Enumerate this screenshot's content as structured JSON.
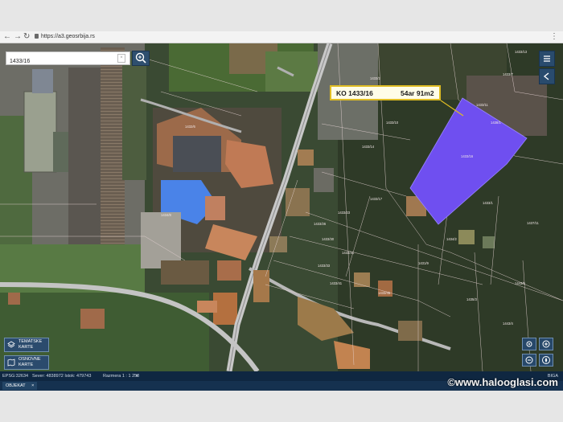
{
  "browser": {
    "back_icon": "arrow-left",
    "forward_icon": "arrow-right",
    "reload_icon": "reload",
    "url": "https://a3.geosrbija.rs",
    "menu_icon": "three-dots"
  },
  "search": {
    "value": "1433/16",
    "clear_label": "×",
    "button_icon": "search-zoom"
  },
  "right_toolbar": [
    {
      "icon": "menu-lines"
    },
    {
      "icon": "collapse-arrow"
    }
  ],
  "callout": {
    "parcel": "KO 1433/16",
    "area": "54ar 91m2"
  },
  "layers": [
    {
      "label": "TEMATSKE KARTE"
    },
    {
      "label": "OSNOVNE KARTE"
    }
  ],
  "map_controls": [
    {
      "icon": "locate"
    },
    {
      "icon": "zoom-in"
    },
    {
      "icon": "zoom-out"
    },
    {
      "icon": "compass"
    }
  ],
  "status": {
    "projection": "EPSG:32634",
    "coords": "Sever: 4838972 Istok: 479743",
    "scale": "Razmera 1 : 1 250",
    "scale_arrow": "▾",
    "brand": "BIGA"
  },
  "footer": {
    "tab": "OBJEKAT",
    "tab_close": "×"
  },
  "watermark": "©www.halooglasi.com",
  "parcel_labels": [
    "1433/2",
    "1433/7",
    "1433/5",
    "1433/13",
    "1433/9",
    "1433/11",
    "1433/10",
    "1433/14",
    "1433/17",
    "1433/23",
    "1433/26",
    "1433/30",
    "1433/31",
    "1433/33",
    "1433/41",
    "1433/45",
    "1433/1",
    "1434/2",
    "1431/9",
    "1435/3",
    "1443/5",
    "1443/4",
    "1432/6",
    "1434/8",
    "1433/16",
    "1437/11",
    "1438/1"
  ],
  "colors": {
    "highlight_parcel": "#6f4ff0",
    "callout_border": "#e0bd23",
    "toolbar": "#294b6d",
    "statusbar": "#0f2741",
    "blue_roof": "#4a83e8"
  }
}
